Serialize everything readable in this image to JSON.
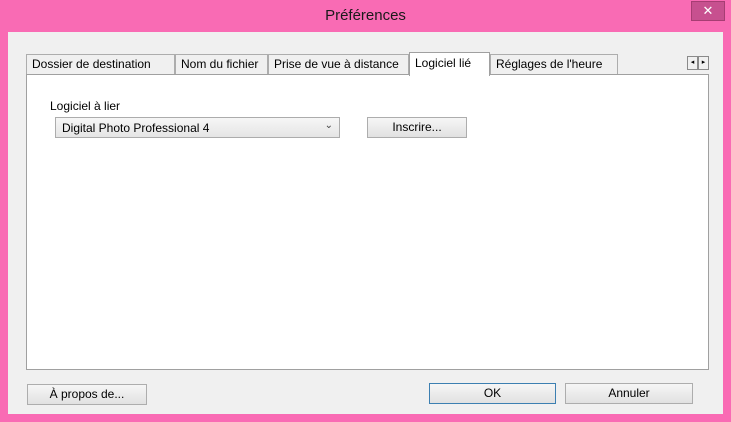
{
  "window": {
    "title": "Préférences",
    "close_glyph": "✕"
  },
  "tabs": [
    {
      "label": "Dossier de destination",
      "active": false
    },
    {
      "label": "Nom du fichier",
      "active": false
    },
    {
      "label": "Prise de vue à distance",
      "active": false
    },
    {
      "label": "Logiciel lié",
      "active": true
    },
    {
      "label": "Réglages de l'heure",
      "active": false
    }
  ],
  "tab_scroll": {
    "left_icon": "◂",
    "right_icon": "▸"
  },
  "linked_software": {
    "label": "Logiciel à lier",
    "selected": "Digital Photo Professional 4",
    "dropdown_icon": "⌄",
    "register_button": "Inscrire..."
  },
  "footer": {
    "about_button": "À propos de...",
    "ok_button": "OK",
    "cancel_button": "Annuler"
  },
  "colors": {
    "accent_frame": "#f96bb4",
    "close_button": "#c7508f"
  }
}
